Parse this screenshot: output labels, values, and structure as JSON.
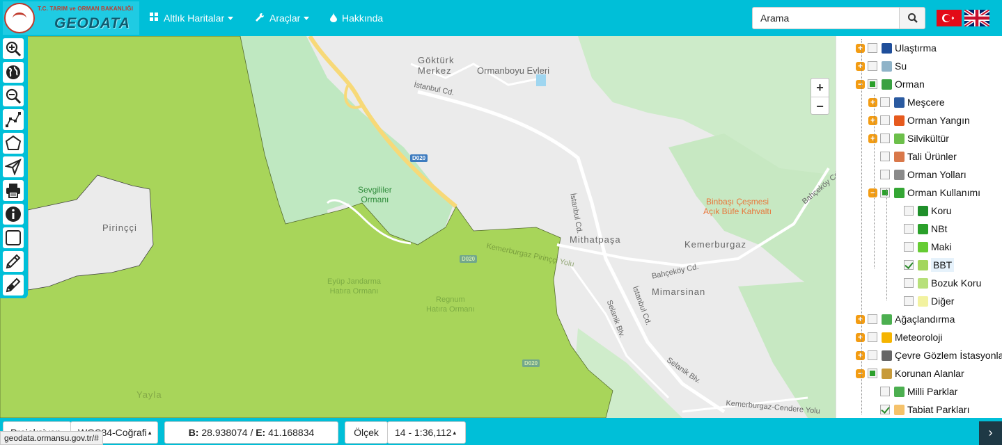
{
  "brand": {
    "ministry": "T.C. TARIM ve ORMAN BAKANLIĞI",
    "logo": "GEODATA"
  },
  "nav": {
    "base_maps": "Altlık Haritalar",
    "tools": "Araçlar",
    "about": "Hakkında"
  },
  "search": {
    "placeholder": "Arama",
    "icon": "search-icon"
  },
  "flags": [
    "turkish-flag",
    "uk-flag"
  ],
  "map": {
    "labels": {
      "gokturk": "Göktürk\nMerkez",
      "ormanboyu": "Ormanboyu Evleri",
      "istanbul_cd_1": "İstanbul Cd.",
      "istanbul_cd_2": "İstanbul Cd.",
      "istanbul_cd_3": "İstanbul Cd.",
      "sevgililer": "Sevgililer\nOrmanı",
      "binbasi": "Binbaşı Çeşmesi\nAçık Büfe Kahvaltı",
      "mithatpasa": "Mithatpaşa",
      "kemerburgaz": "Kemerburgaz",
      "mimarsinan": "Mimarsinan",
      "bahcekoy_cd_1": "Bahçeköy Cd.",
      "bahcekoy_cd_2": "Bahçeköy Cd.",
      "selanik_1": "Selanik Blv.",
      "selanik_2": "Selanik Blv.",
      "kemerburgaz_cendere": "Kemerburgaz-Cendere Yolu",
      "pirincci": "Pirinççi",
      "eyup": "Eyüp Jandarma\nHatıra Ormanı",
      "regnum": "Regnum\nHatıra Ormanı",
      "yayla": "Yayla",
      "kemerburgaz_pirincci": "Kemerburgaz Pirinççi Yolu",
      "d020_1": "D020",
      "d020_2": "D020",
      "d020_3": "D020"
    },
    "zoom_in": "+",
    "zoom_out": "−"
  },
  "layers": [
    {
      "label": "Ulaştırma",
      "level": 0,
      "expander": "+",
      "checked": "none",
      "icon": "transport-icon",
      "color": "#1f4e9a"
    },
    {
      "label": "Su",
      "level": 0,
      "expander": "+",
      "checked": "none",
      "icon": "water-icon",
      "color": "#8fb3c8"
    },
    {
      "label": "Orman",
      "level": 0,
      "expander": "−",
      "checked": "partial",
      "icon": "tree-icon",
      "color": "#3aa142"
    },
    {
      "label": "Meşcere",
      "level": 1,
      "expander": "+",
      "checked": "none",
      "icon": "stand-icon",
      "color": "#2a5aa0"
    },
    {
      "label": "Orman Yangın",
      "level": 1,
      "expander": "+",
      "checked": "none",
      "icon": "fire-icon",
      "color": "#e65a1e"
    },
    {
      "label": "Silvikültür",
      "level": 1,
      "expander": "+",
      "checked": "none",
      "icon": "sapling-icon",
      "color": "#6cbf4a"
    },
    {
      "label": "Tali Ürünler",
      "level": 1,
      "expander": "",
      "checked": "none",
      "icon": "secondary-products-icon",
      "color": "#d9784a"
    },
    {
      "label": "Orman Yolları",
      "level": 1,
      "expander": "",
      "checked": "none",
      "icon": "forest-road-icon",
      "color": "#8a8a8a"
    },
    {
      "label": "Orman Kullanımı",
      "level": 1,
      "expander": "−",
      "checked": "partial",
      "icon": "clover-icon",
      "color": "#34a634"
    },
    {
      "label": "Koru",
      "level": 2,
      "expander": "",
      "checked": "none",
      "icon": "koru-swatch-icon",
      "color": "#1f8f2a"
    },
    {
      "label": "NBt",
      "level": 2,
      "expander": "",
      "checked": "none",
      "icon": "nbt-swatch-icon",
      "color": "#2aa02a"
    },
    {
      "label": "Maki",
      "level": 2,
      "expander": "",
      "checked": "none",
      "icon": "maki-swatch-icon",
      "color": "#66cc33"
    },
    {
      "label": "BBT",
      "level": 2,
      "expander": "",
      "checked": "checked",
      "icon": "bbt-swatch-icon",
      "color": "#a3d65c",
      "highlight": true
    },
    {
      "label": "Bozuk Koru",
      "level": 2,
      "expander": "",
      "checked": "none",
      "icon": "bozuk-koru-swatch-icon",
      "color": "#b7e07a"
    },
    {
      "label": "Diğer",
      "level": 2,
      "expander": "",
      "checked": "none",
      "icon": "diger-swatch-icon",
      "color": "#f2f2a0"
    },
    {
      "label": "Ağaçlandırma",
      "level": 0,
      "expander": "+",
      "checked": "none",
      "icon": "afforestation-icon",
      "color": "#4caf50"
    },
    {
      "label": "Meteoroloji",
      "level": 0,
      "expander": "+",
      "checked": "none",
      "icon": "weather-icon",
      "color": "#f5b400"
    },
    {
      "label": "Çevre Gözlem İstasyonları",
      "level": 0,
      "expander": "+",
      "checked": "none",
      "icon": "station-icon",
      "color": "#666666"
    },
    {
      "label": "Korunan Alanlar",
      "level": 0,
      "expander": "−",
      "checked": "partial",
      "icon": "protected-area-icon",
      "color": "#c79a3a"
    },
    {
      "label": "Milli Parklar",
      "level": 1,
      "expander": "",
      "checked": "none",
      "icon": "national-park-icon",
      "color": "#4caf50"
    },
    {
      "label": "Tabiat Parkları",
      "level": 1,
      "expander": "",
      "checked": "checked",
      "icon": "nature-park-icon",
      "color": "#f5c26b"
    }
  ],
  "bottom": {
    "projection_label": "Projeksiyon",
    "projection_value": "WGS84-Coğrafi",
    "coords_b_label": "B:",
    "coords_b": "28.938074",
    "coords_sep": "/",
    "coords_e_label": "E:",
    "coords_e": "41.168834",
    "scale_label": "Ölçek",
    "scale_value": "14 - 1:36,112"
  },
  "status_url": "geodata.ormansu.gov.tr/#",
  "next_button": "›"
}
